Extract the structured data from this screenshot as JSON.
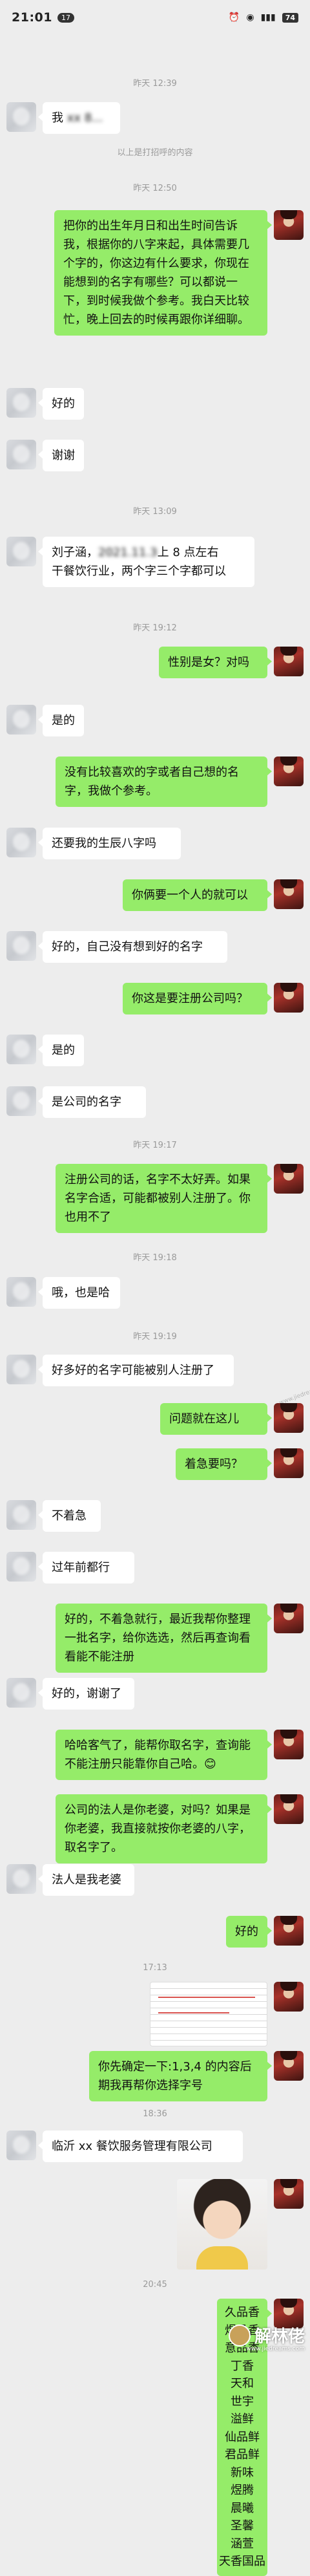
{
  "status_bar": {
    "time": "21:01",
    "badge": "17",
    "battery": "74"
  },
  "timestamps": {
    "t1": "昨天 12:39",
    "t_sys": "以上是打招呼的内容",
    "t2": "昨天 12:50",
    "t3": "昨天 13:09",
    "t4": "昨天 19:12",
    "t5": "昨天 19:17",
    "t6": "昨天 19:18",
    "t7": "昨天 19:19",
    "t8": "17:13",
    "t9": "18:36",
    "t10": "20:45"
  },
  "messages": {
    "m1": "我",
    "m2": "把你的出生年月日和出生时间告诉我，根据你的八字来起，具体需要几个字的，你这边有什么要求，你现在能想到的名字有哪些？可以都说一下，到时候我做个参考。我白天比较忙，晚上回去的时候再跟你详细聊。",
    "m3": "好的",
    "m4": "谢谢",
    "m5": "刘子涵，",
    "m5_tail": "上 8 点左右",
    "m5_2": "干餐饮行业，两个字三个字都可以",
    "m6": "性别是女？对吗",
    "m7": "是的",
    "m8": "没有比较喜欢的字或者自己想的名字，我做个参考。",
    "m9": "还要我的生辰八字吗",
    "m10": "你俩要一个人的就可以",
    "m11": "好的，自己没有想到好的名字",
    "m12": "你这是要注册公司吗？",
    "m13": "是的",
    "m14": "是公司的名字",
    "m15": "注册公司的话，名字不太好弄。如果名字合适，可能都被别人注册了。你也用不了",
    "m16": "哦，也是哈",
    "m17": "好多好的名字可能被别人注册了",
    "m18": "问题就在这儿",
    "m19": "着急要吗？",
    "m20": "不着急",
    "m21": "过年前都行",
    "m22": "好的，不着急就行，最近我帮你整理一批名字，给你选选，然后再查询看看能不能注册",
    "m23": "好的，谢谢了",
    "m24": "哈哈客气了，能帮你取名字，查询能不能注册只能靠你自己哈。😊",
    "m25": "公司的法人是你老婆，对吗？如果是你老婆，我直接就按你老婆的八字，取名字了。",
    "m26": "法人是我老婆",
    "m27": "好的",
    "m28": "你先确定一下:1,3,4 的内容后期我再帮你选择字号",
    "m29": "临沂 xx 餐饮服务管理有限公司"
  },
  "name_list": [
    "久品香",
    "煜品香",
    "意品香",
    "丁香",
    "天和",
    "世宇",
    "溢鲜",
    "仙品鲜",
    "君品鲜",
    "新味",
    "煜腾",
    "晨曦",
    "圣馨",
    "涵萱",
    "天香国品"
  ],
  "watermark": {
    "main": "解林佬",
    "sub": "www.jiedreams.com"
  }
}
